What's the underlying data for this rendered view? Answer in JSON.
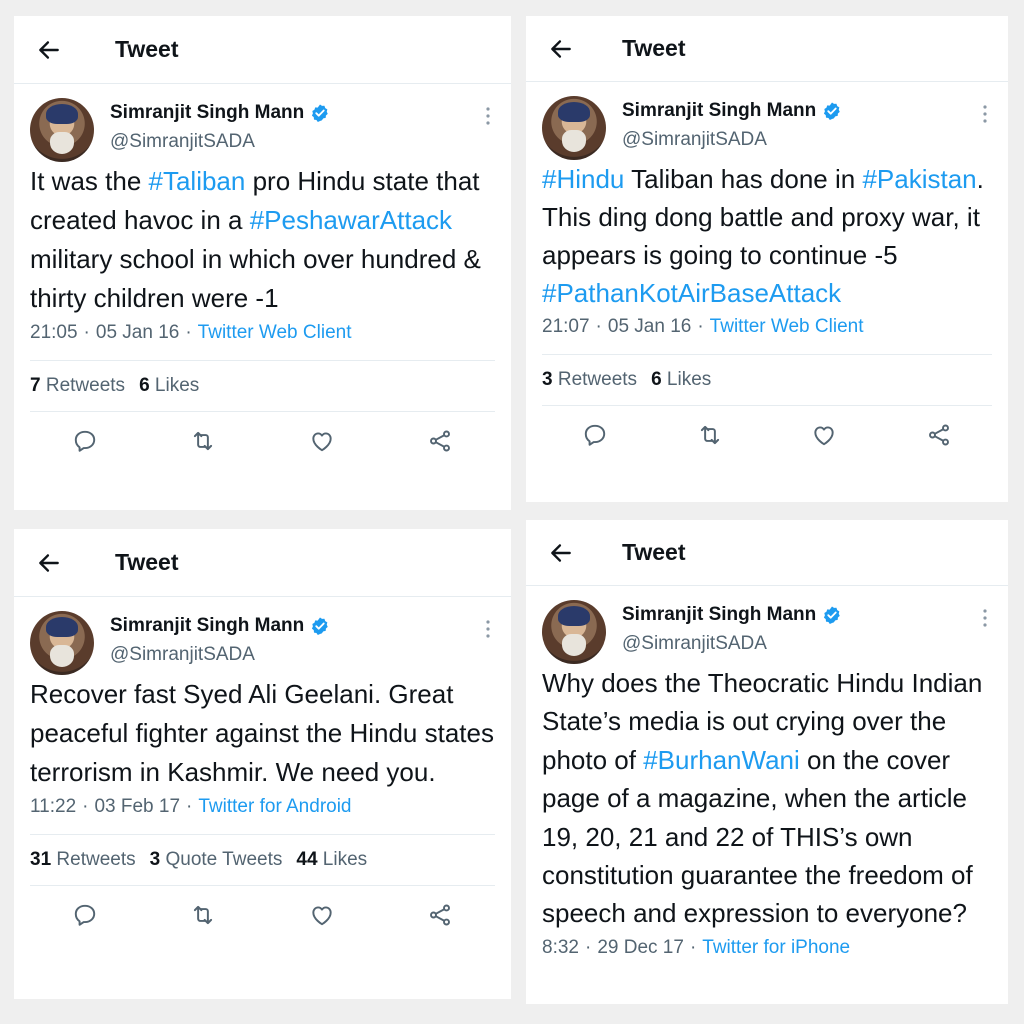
{
  "header": {
    "title": "Tweet"
  },
  "author": {
    "name": "Simranjit Singh Mann",
    "handle": "@SimranjitSADA"
  },
  "colors": {
    "link": "#1d9bf0",
    "muted": "#536471",
    "text": "#0f1419"
  },
  "tweets": [
    {
      "text": [
        {
          "t": "It was the "
        },
        {
          "t": "#Taliban",
          "tag": true
        },
        {
          "t": " pro Hindu state that created havoc in a "
        },
        {
          "t": "#PeshawarAttack",
          "tag": true
        },
        {
          "t": " military school in which over hundred & thirty children were -1"
        }
      ],
      "time": "21:05",
      "date": "05 Jan 16",
      "client": "Twitter Web Client",
      "stats": [
        {
          "count": "7",
          "label": "Retweets"
        },
        {
          "count": "6",
          "label": "Likes"
        }
      ]
    },
    {
      "text": [
        {
          "t": "#Hindu",
          "tag": true
        },
        {
          "t": " Taliban has done in "
        },
        {
          "t": "#Pakistan",
          "tag": true
        },
        {
          "t": ". This ding dong battle and proxy war, it appears is going to continue -5 "
        },
        {
          "t": "#PathanKotAirBaseAttack",
          "tag": true
        }
      ],
      "time": "21:07",
      "date": "05 Jan 16",
      "client": "Twitter Web Client",
      "stats": [
        {
          "count": "3",
          "label": "Retweets"
        },
        {
          "count": "6",
          "label": "Likes"
        }
      ]
    },
    {
      "text": [
        {
          "t": "Recover fast Syed Ali Geelani. Great peaceful fighter against the Hindu states terrorism in Kashmir. We need you."
        }
      ],
      "time": "11:22",
      "date": "03 Feb 17",
      "client": "Twitter for Android",
      "stats": [
        {
          "count": "31",
          "label": "Retweets"
        },
        {
          "count": "3",
          "label": "Quote Tweets"
        },
        {
          "count": "44",
          "label": "Likes"
        }
      ]
    },
    {
      "text": [
        {
          "t": "Why does the Theocratic Hindu Indian State’s media is out crying over the photo of "
        },
        {
          "t": "#BurhanWani",
          "tag": true
        },
        {
          "t": " on the cover page of a magazine, when the article 19, 20, 21 and 22 of THIS’s own constitution guarantee the freedom of speech and expression to everyone?"
        }
      ],
      "time": "8:32",
      "date": "29 Dec 17",
      "client": "Twitter for iPhone",
      "stats": []
    }
  ],
  "icons": {
    "back": "arrow-left-icon",
    "verified": "verified-badge-icon",
    "more": "more-vertical-icon",
    "reply": "reply-icon",
    "retweet": "retweet-icon",
    "like": "heart-icon",
    "share": "share-icon"
  }
}
